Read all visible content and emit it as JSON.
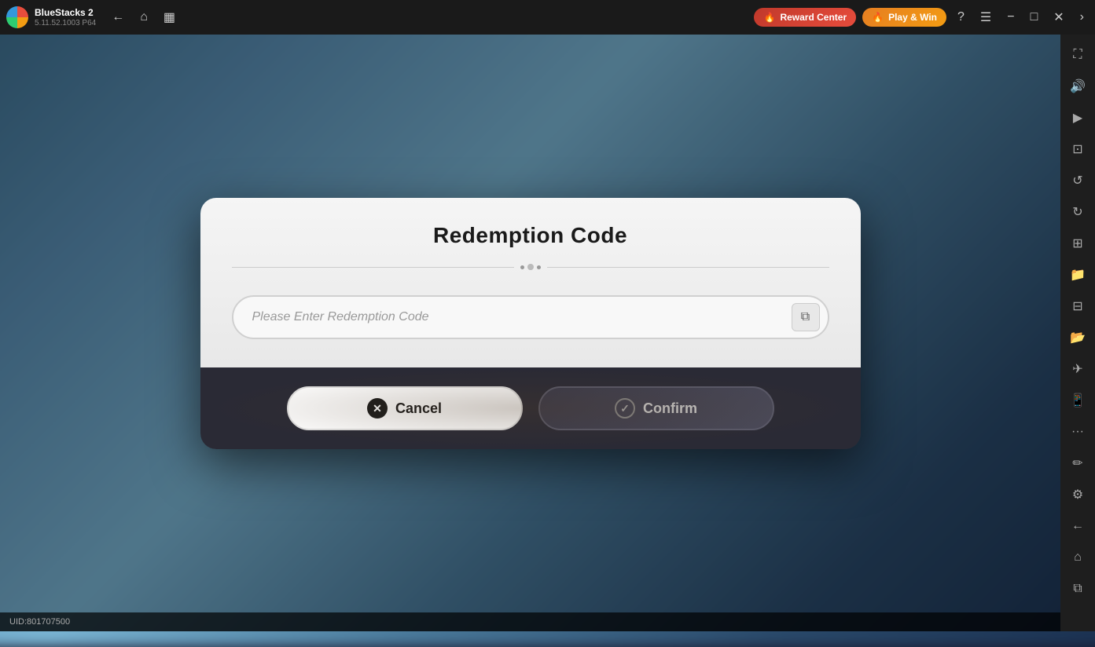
{
  "app": {
    "name": "BlueStacks 2",
    "version": "5.11.52.1003  P64"
  },
  "topbar": {
    "back_label": "←",
    "home_label": "⌂",
    "recent_label": "❐",
    "reward_label": "Reward Center",
    "reward_icon": "🔥",
    "play_label": "Play & Win",
    "play_icon": "🔥"
  },
  "dialog": {
    "title": "Redemption Code",
    "input_placeholder": "Please Enter Redemption Code",
    "cancel_label": "Cancel",
    "confirm_label": "Confirm"
  },
  "status": {
    "uid": "UID:801707500"
  },
  "sidebar_icons": [
    {
      "name": "expand-icon",
      "glyph": "⛶"
    },
    {
      "name": "volume-icon",
      "glyph": "🔊"
    },
    {
      "name": "video-icon",
      "glyph": "▶"
    },
    {
      "name": "camera-icon",
      "glyph": "📷"
    },
    {
      "name": "history-icon",
      "glyph": "↺"
    },
    {
      "name": "refresh-icon",
      "glyph": "↻"
    },
    {
      "name": "apps-icon",
      "glyph": "⊞"
    },
    {
      "name": "file-icon",
      "glyph": "📁"
    },
    {
      "name": "screenshot-icon",
      "glyph": "📷"
    },
    {
      "name": "folder-icon",
      "glyph": "📂"
    },
    {
      "name": "location-icon",
      "glyph": "✈"
    },
    {
      "name": "phone-icon",
      "glyph": "📱"
    },
    {
      "name": "more-icon",
      "glyph": "•••"
    },
    {
      "name": "edit-icon",
      "glyph": "✏"
    },
    {
      "name": "settings-icon",
      "glyph": "⚙"
    },
    {
      "name": "back-icon",
      "glyph": "←"
    },
    {
      "name": "home-icon",
      "glyph": "⌂"
    },
    {
      "name": "copy-icon",
      "glyph": "⧉"
    }
  ]
}
